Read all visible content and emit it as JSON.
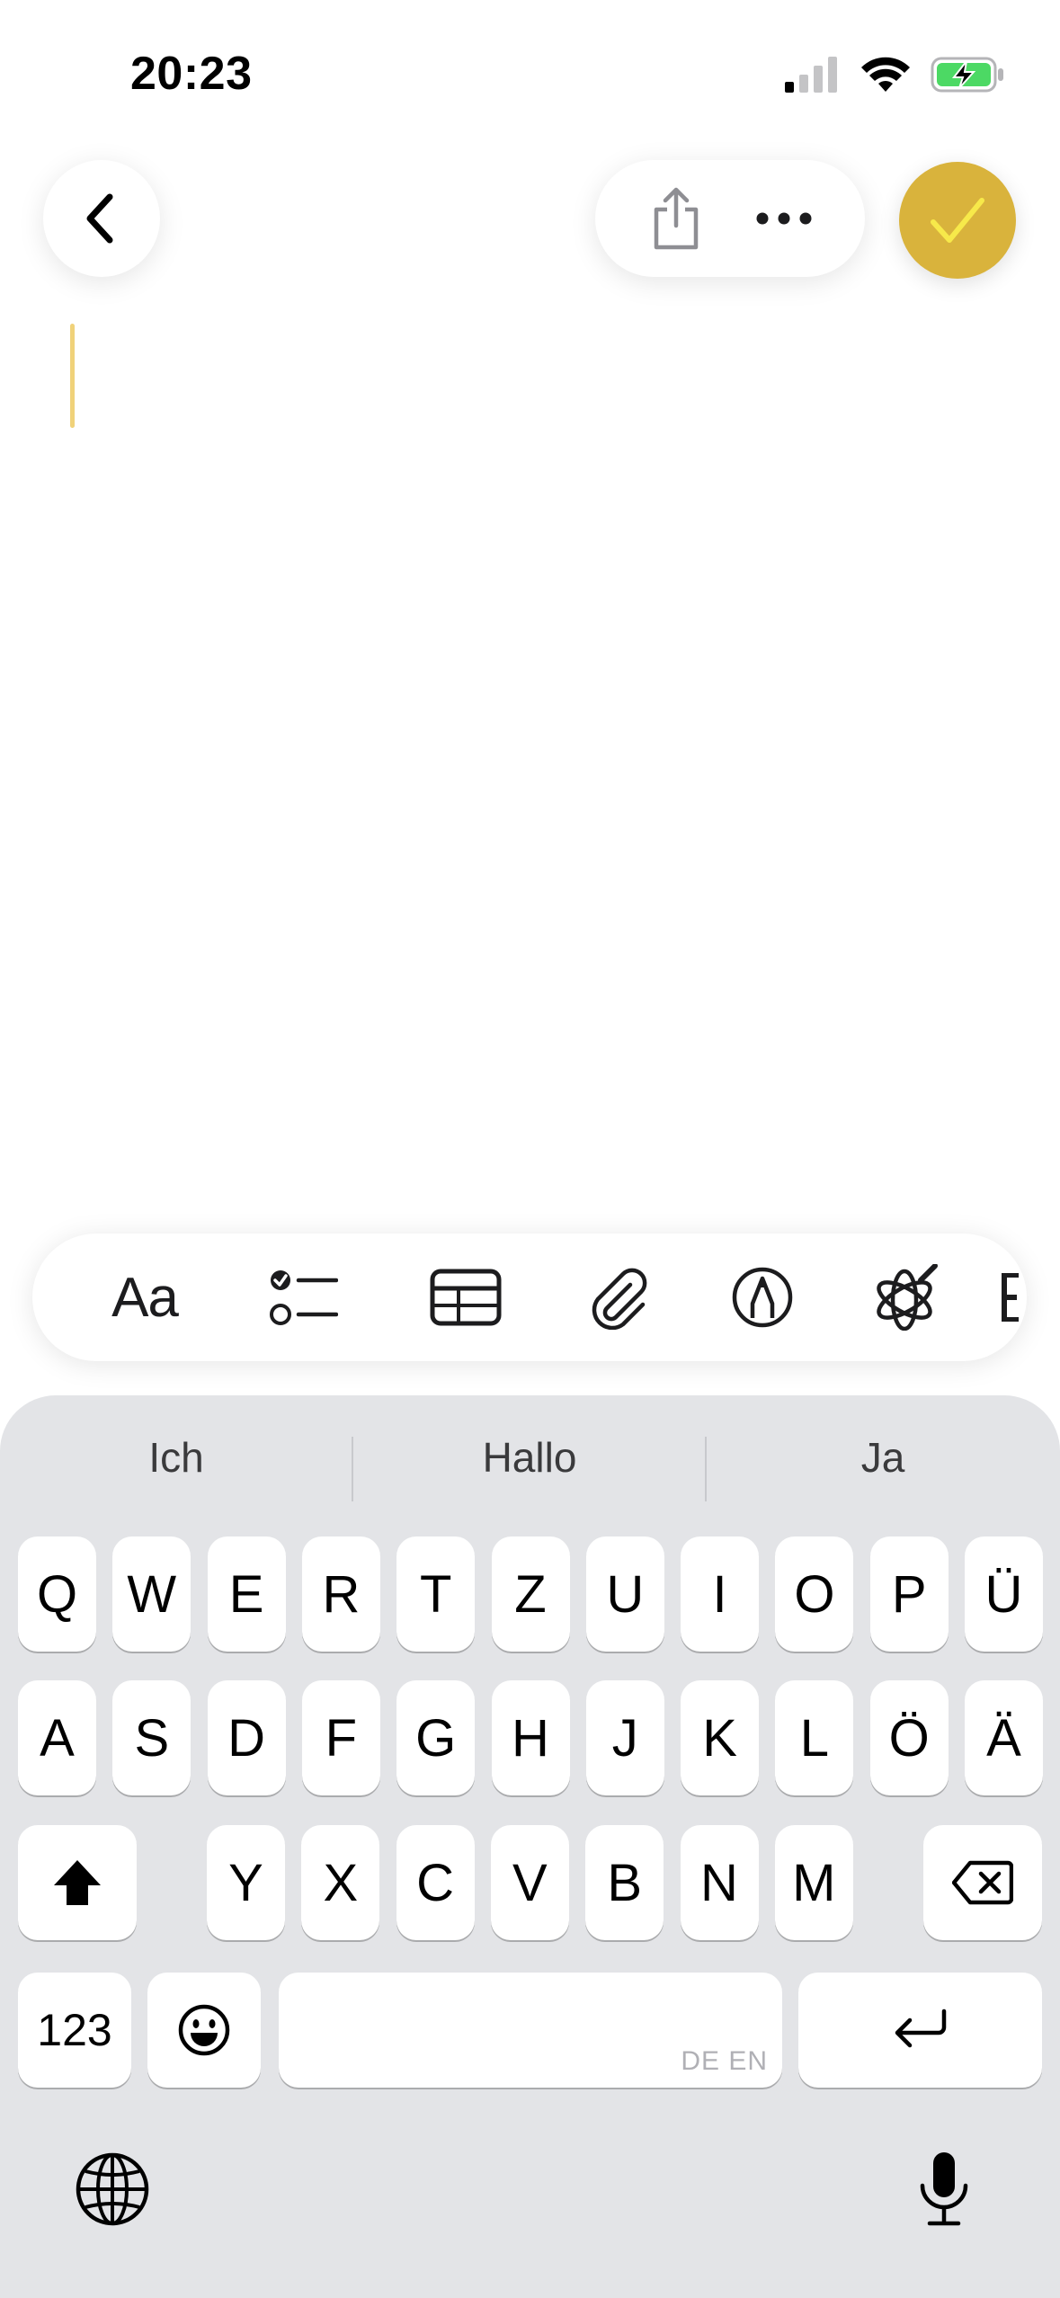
{
  "status_bar": {
    "time": "20:23"
  },
  "suggestions": [
    "Ich",
    "Hallo",
    "Ja"
  ],
  "keyboard": {
    "row1": [
      "Q",
      "W",
      "E",
      "R",
      "T",
      "Z",
      "U",
      "I",
      "O",
      "P",
      "Ü"
    ],
    "row2": [
      "A",
      "S",
      "D",
      "F",
      "G",
      "H",
      "J",
      "K",
      "L",
      "Ö",
      "Ä"
    ],
    "row3": [
      "Y",
      "X",
      "C",
      "V",
      "B",
      "N",
      "M"
    ],
    "numbers_label": "123",
    "space_languages": "DE EN"
  },
  "toolbar": {
    "format_label": "Aa"
  },
  "colors": {
    "accent": "#d9b33c",
    "check": "#f7e94a",
    "keyboard_bg": "#e3e4e7"
  },
  "icons": {
    "back": "chevron-left-icon",
    "share": "share-icon",
    "more": "ellipsis-icon",
    "done": "checkmark-icon",
    "checklist": "checklist-icon",
    "table": "table-icon",
    "attach": "paperclip-icon",
    "markup": "pen-circle-icon",
    "ai": "writing-tools-icon",
    "shift": "shift-icon",
    "delete": "delete-icon",
    "emoji": "emoji-icon",
    "return": "return-icon",
    "globe": "globe-icon",
    "mic": "microphone-icon"
  }
}
